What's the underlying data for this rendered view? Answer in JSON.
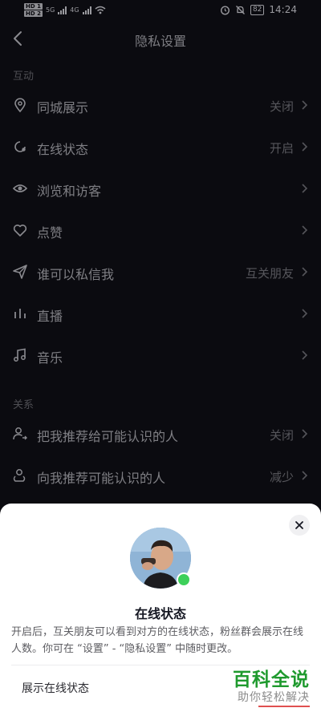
{
  "status_bar": {
    "hd1": "HD 1",
    "hd2": "HD 2",
    "net1": "5G",
    "net2": "4G",
    "battery": "82",
    "time": "14:24"
  },
  "header": {
    "title": "隐私设置"
  },
  "sections": {
    "interaction": "互动",
    "relations": "关系"
  },
  "rows": [
    {
      "label": "同城展示",
      "value": "关闭"
    },
    {
      "label": "在线状态",
      "value": "开启"
    },
    {
      "label": "浏览和访客",
      "value": ""
    },
    {
      "label": "点赞",
      "value": ""
    },
    {
      "label": "谁可以私信我",
      "value": "互关朋友"
    },
    {
      "label": "直播",
      "value": ""
    },
    {
      "label": "音乐",
      "value": ""
    },
    {
      "label": "把我推荐给可能认识的人",
      "value": "关闭"
    },
    {
      "label": "向我推荐可能认识的人",
      "value": "减少"
    }
  ],
  "sheet": {
    "title": "在线状态",
    "description": "开启后，互关朋友可以看到对方的在线状态，粉丝群会展示在线人数。你可在 “设置” - “隐私设置” 中随时更改。",
    "option_label": "展示在线状态"
  },
  "watermark": {
    "main": "百科全说",
    "sub": "助你轻松解决"
  },
  "colors": {
    "background": "#0b0b10",
    "sheet": "#ffffff",
    "online": "#3dd05a",
    "watermark": "#1f9a2e"
  }
}
